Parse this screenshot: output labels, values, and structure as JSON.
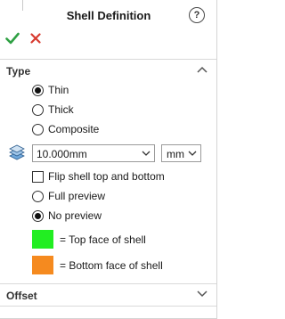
{
  "header": {
    "title": "Shell Definition",
    "help_glyph": "?"
  },
  "actions": {
    "ok_icon": "checkmark-icon",
    "cancel_icon": "x-icon",
    "ok_color": "#2ea043",
    "cancel_color": "#d73a2f"
  },
  "type_section": {
    "label": "Type",
    "options": [
      {
        "label": "Thin",
        "selected": true
      },
      {
        "label": "Thick",
        "selected": false
      },
      {
        "label": "Composite",
        "selected": false
      }
    ],
    "thickness": {
      "value": "10.000mm",
      "unit": "mm"
    },
    "flip": {
      "label": "Flip shell top and bottom",
      "checked": false
    },
    "preview": [
      {
        "label": "Full preview",
        "selected": false
      },
      {
        "label": "No preview",
        "selected": true
      }
    ],
    "legend": [
      {
        "color": "#22ee22",
        "label": "= Top face of shell"
      },
      {
        "color": "#f58a1f",
        "label": "= Bottom face of shell"
      }
    ]
  },
  "offset_section": {
    "label": "Offset"
  }
}
